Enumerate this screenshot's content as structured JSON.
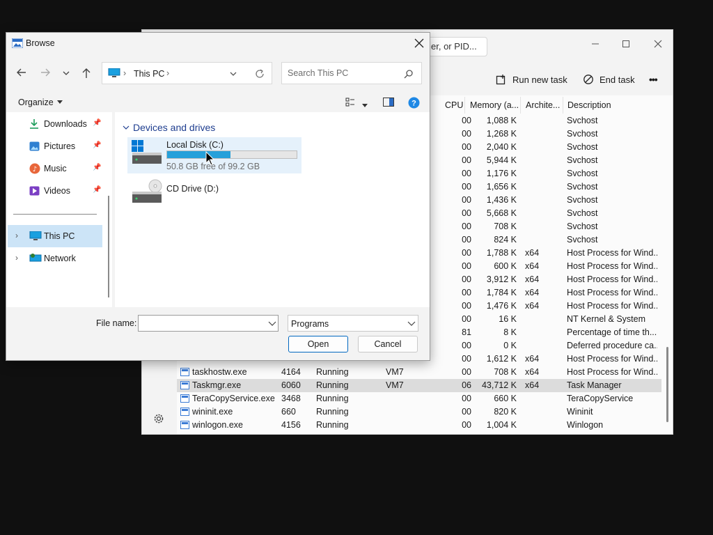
{
  "task_manager": {
    "search_fragment": "er, or PID...",
    "commands": {
      "run_new_task": "Run new task",
      "end_task": "End task",
      "more": "•••"
    },
    "columns": {
      "cpu": "CPU",
      "memory": "Memory (a...",
      "architecture": "Archite...",
      "description": "Description"
    },
    "rows": [
      {
        "name": "",
        "pid": "",
        "status": "",
        "user": "",
        "cpu": "00",
        "mem": "1,088 K",
        "arch": "",
        "desc": "Svchost"
      },
      {
        "name": "",
        "pid": "",
        "status": "",
        "user": "",
        "cpu": "00",
        "mem": "1,268 K",
        "arch": "",
        "desc": "Svchost"
      },
      {
        "name": "",
        "pid": "",
        "status": "",
        "user": "",
        "cpu": "00",
        "mem": "2,040 K",
        "arch": "",
        "desc": "Svchost"
      },
      {
        "name": "",
        "pid": "",
        "status": "",
        "user": "",
        "cpu": "00",
        "mem": "5,944 K",
        "arch": "",
        "desc": "Svchost"
      },
      {
        "name": "",
        "pid": "",
        "status": "",
        "user": "",
        "cpu": "00",
        "mem": "1,176 K",
        "arch": "",
        "desc": "Svchost"
      },
      {
        "name": "",
        "pid": "",
        "status": "",
        "user": "",
        "cpu": "00",
        "mem": "1,656 K",
        "arch": "",
        "desc": "Svchost"
      },
      {
        "name": "",
        "pid": "",
        "status": "",
        "user": "",
        "cpu": "00",
        "mem": "1,436 K",
        "arch": "",
        "desc": "Svchost"
      },
      {
        "name": "",
        "pid": "",
        "status": "",
        "user": "",
        "cpu": "00",
        "mem": "5,668 K",
        "arch": "",
        "desc": "Svchost"
      },
      {
        "name": "",
        "pid": "",
        "status": "",
        "user": "",
        "cpu": "00",
        "mem": "708 K",
        "arch": "",
        "desc": "Svchost"
      },
      {
        "name": "",
        "pid": "",
        "status": "",
        "user": "",
        "cpu": "00",
        "mem": "824 K",
        "arch": "",
        "desc": "Svchost"
      },
      {
        "name": "",
        "pid": "",
        "status": "",
        "user": "",
        "cpu": "00",
        "mem": "1,788 K",
        "arch": "x64",
        "desc": "Host Process for Wind..."
      },
      {
        "name": "",
        "pid": "",
        "status": "",
        "user": "",
        "cpu": "00",
        "mem": "600 K",
        "arch": "x64",
        "desc": "Host Process for Wind..."
      },
      {
        "name": "",
        "pid": "",
        "status": "",
        "user": "",
        "cpu": "00",
        "mem": "3,912 K",
        "arch": "x64",
        "desc": "Host Process for Wind..."
      },
      {
        "name": "",
        "pid": "",
        "status": "",
        "user": "",
        "cpu": "00",
        "mem": "1,784 K",
        "arch": "x64",
        "desc": "Host Process for Wind..."
      },
      {
        "name": "",
        "pid": "",
        "status": "",
        "user": "",
        "cpu": "00",
        "mem": "1,476 K",
        "arch": "x64",
        "desc": "Host Process for Wind..."
      },
      {
        "name": "",
        "pid": "",
        "status": "",
        "user": "",
        "cpu": "00",
        "mem": "16 K",
        "arch": "",
        "desc": "NT Kernel & System"
      },
      {
        "name": "",
        "pid": "",
        "status": "",
        "user": "",
        "cpu": "81",
        "mem": "8 K",
        "arch": "",
        "desc": "Percentage of time th..."
      },
      {
        "name": "",
        "pid": "",
        "status": "",
        "user": "",
        "cpu": "00",
        "mem": "0 K",
        "arch": "",
        "desc": "Deferred procedure ca..."
      },
      {
        "name": "",
        "pid": "",
        "status": "",
        "user": "",
        "cpu": "00",
        "mem": "1,612 K",
        "arch": "x64",
        "desc": "Host Process for Wind..."
      },
      {
        "name": "taskhostw.exe",
        "pid": "4164",
        "status": "Running",
        "user": "VM7",
        "cpu": "00",
        "mem": "708 K",
        "arch": "x64",
        "desc": "Host Process for Wind..."
      },
      {
        "name": "Taskmgr.exe",
        "pid": "6060",
        "status": "Running",
        "user": "VM7",
        "cpu": "06",
        "mem": "43,712 K",
        "arch": "x64",
        "desc": "Task Manager",
        "selected": true
      },
      {
        "name": "TeraCopyService.exe",
        "pid": "3468",
        "status": "Running",
        "user": "",
        "cpu": "00",
        "mem": "660 K",
        "arch": "",
        "desc": "TeraCopyService"
      },
      {
        "name": "wininit.exe",
        "pid": "660",
        "status": "Running",
        "user": "",
        "cpu": "00",
        "mem": "820 K",
        "arch": "",
        "desc": "Wininit"
      },
      {
        "name": "winlogon.exe",
        "pid": "4156",
        "status": "Running",
        "user": "",
        "cpu": "00",
        "mem": "1,004 K",
        "arch": "",
        "desc": "Winlogon"
      }
    ]
  },
  "browse_dialog": {
    "title": "Browse",
    "breadcrumb": [
      "This PC"
    ],
    "search_placeholder": "Search This PC",
    "organize_label": "Organize",
    "nav_items": [
      {
        "label": "Downloads",
        "icon": "download-icon",
        "pinned": true
      },
      {
        "label": "Pictures",
        "icon": "pictures-icon",
        "pinned": true
      },
      {
        "label": "Music",
        "icon": "music-icon",
        "pinned": true
      },
      {
        "label": "Videos",
        "icon": "videos-icon",
        "pinned": true
      }
    ],
    "tree_items": [
      {
        "label": "This PC",
        "selected": true
      },
      {
        "label": "Network",
        "selected": false
      }
    ],
    "group_header": "Devices and drives",
    "drives": [
      {
        "name": "Local Disk (C:)",
        "free_text": "50.8 GB free of 99.2 GB",
        "used_fraction": 0.488,
        "selected": true
      },
      {
        "name": "CD Drive (D:)"
      }
    ],
    "file_name_label": "File name:",
    "file_name_value": "",
    "file_type": "Programs",
    "open_label": "Open",
    "cancel_label": "Cancel"
  }
}
